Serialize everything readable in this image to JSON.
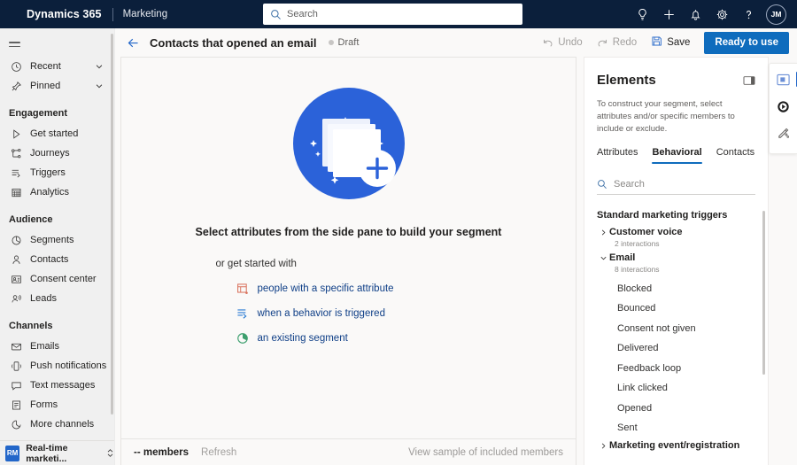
{
  "header": {
    "brand": "Dynamics 365",
    "app_name": "Marketing",
    "search_placeholder": "Search",
    "icons": [
      {
        "name": "lightbulb-icon",
        "label": "Ideas"
      },
      {
        "name": "plus-icon",
        "label": "New"
      },
      {
        "name": "bell-icon",
        "label": "Notifications"
      },
      {
        "name": "gear-icon",
        "label": "Settings"
      },
      {
        "name": "question-icon",
        "label": "Help"
      }
    ],
    "avatar_initials": "JM",
    "background_color": "#0b1f3b"
  },
  "sidebar": {
    "top_items": [
      {
        "label": "Recent",
        "icon": "clock-icon",
        "expandable": true
      },
      {
        "label": "Pinned",
        "icon": "pin-icon",
        "expandable": true
      }
    ],
    "groups": [
      {
        "title": "Engagement",
        "items": [
          {
            "label": "Get started",
            "icon": "play-outline-icon"
          },
          {
            "label": "Journeys",
            "icon": "journeys-icon"
          },
          {
            "label": "Triggers",
            "icon": "triggers-icon"
          },
          {
            "label": "Analytics",
            "icon": "analytics-icon"
          }
        ]
      },
      {
        "title": "Audience",
        "items": [
          {
            "label": "Segments",
            "icon": "segments-icon"
          },
          {
            "label": "Contacts",
            "icon": "person-icon"
          },
          {
            "label": "Consent center",
            "icon": "consent-icon"
          },
          {
            "label": "Leads",
            "icon": "leads-icon"
          }
        ]
      },
      {
        "title": "Channels",
        "items": [
          {
            "label": "Emails",
            "icon": "envelope-icon"
          },
          {
            "label": "Push notifications",
            "icon": "phone-icon"
          },
          {
            "label": "Text messages",
            "icon": "chat-icon"
          },
          {
            "label": "Forms",
            "icon": "form-icon"
          },
          {
            "label": "More channels",
            "icon": "more-channels-icon"
          }
        ]
      }
    ],
    "footer": {
      "badge": "RM",
      "label": "Real-time marketi...",
      "badge_color": "#2266c9"
    }
  },
  "command_bar": {
    "back_label": "Back",
    "page_title": "Contacts that opened an email",
    "status": "Draft",
    "undo_label": "Undo",
    "redo_label": "Redo",
    "save_label": "Save",
    "primary_label": "Ready to use",
    "primary_color": "#0f6cbd"
  },
  "canvas": {
    "empty_title": "Select attributes from the side pane to build your segment",
    "empty_subtitle": "or get started with",
    "options": [
      {
        "label": "people with a specific attribute",
        "icon": "attribute-icon",
        "color": "#d9735e"
      },
      {
        "label": "when a behavior is triggered",
        "icon": "trigger-icon",
        "color": "#2b7cd3"
      },
      {
        "label": "an existing segment",
        "icon": "segment-icon",
        "color": "#3d9f6e"
      }
    ],
    "footer": {
      "member_count": "--",
      "members_label": "members",
      "refresh_label": "Refresh",
      "sample_label": "View sample of included members"
    }
  },
  "elements_panel": {
    "title": "Elements",
    "collapse_icon": "collapse-panel-icon",
    "description": "To construct your segment, select attributes and/or specific members to include or exclude.",
    "tabs": [
      {
        "label": "Attributes",
        "active": false
      },
      {
        "label": "Behavioral",
        "active": true
      },
      {
        "label": "Contacts",
        "active": false
      }
    ],
    "search_placeholder": "Search",
    "tree_group_title": "Standard marketing triggers",
    "nodes": [
      {
        "label": "Customer voice",
        "meta": "2 interactions",
        "expanded": false,
        "children": []
      },
      {
        "label": "Email",
        "meta": "8 interactions",
        "expanded": true,
        "children": [
          "Blocked",
          "Bounced",
          "Consent not given",
          "Delivered",
          "Feedback loop",
          "Link clicked",
          "Opened",
          "Sent"
        ]
      },
      {
        "label": "Marketing event/registration",
        "meta": "",
        "expanded": false,
        "children": []
      }
    ]
  },
  "right_rail": {
    "buttons": [
      {
        "name": "elements-panel-icon",
        "active": true
      },
      {
        "name": "copilot-icon",
        "active": false
      },
      {
        "name": "magic-wand-icon",
        "active": false
      }
    ],
    "accent_color": "#2266c9"
  }
}
